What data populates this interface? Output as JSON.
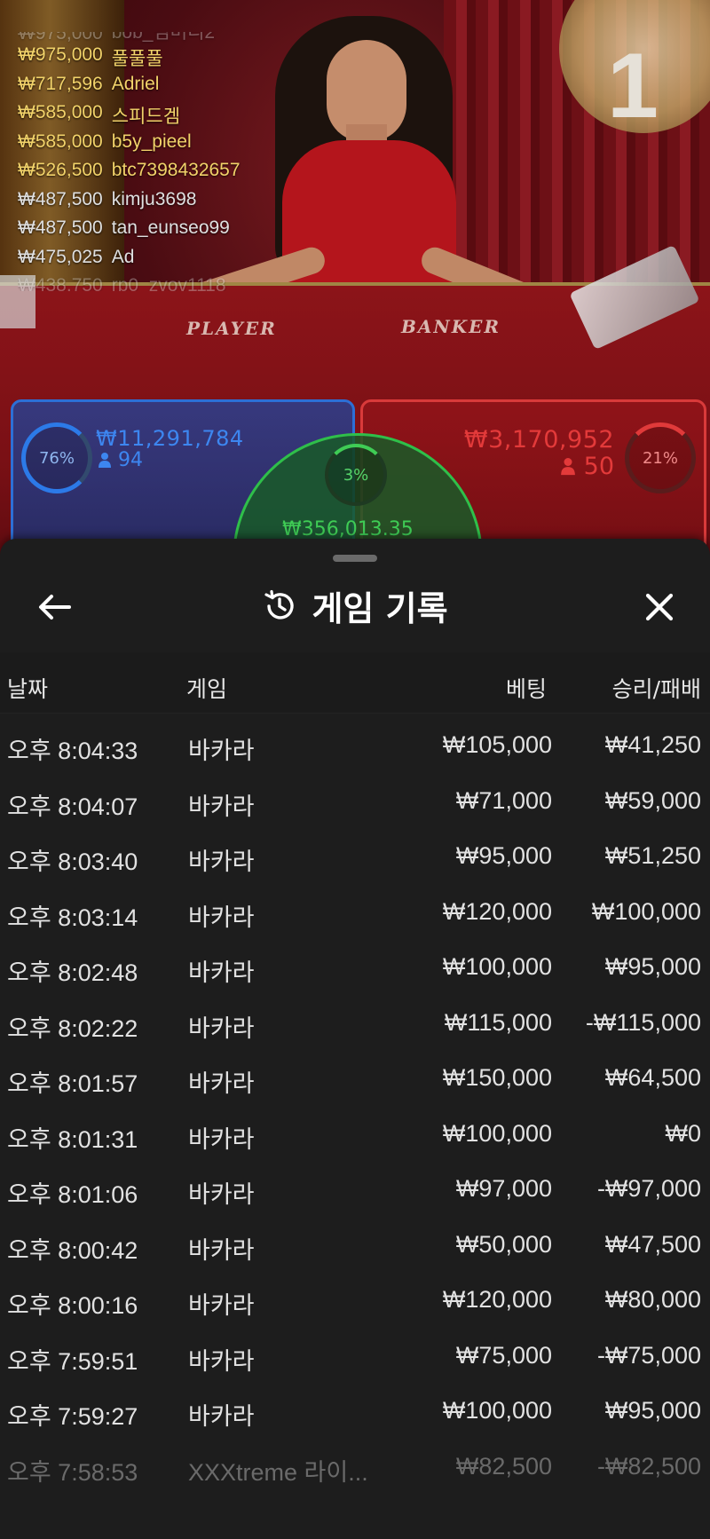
{
  "video": {
    "round_number": "1",
    "table_labels": {
      "player": "PLAYER",
      "banker": "BANKER"
    }
  },
  "leaderboard": [
    {
      "amount": "₩975,000",
      "name": "bob_님버리2",
      "tone": "cut"
    },
    {
      "amount": "₩975,000",
      "name": "풀풀풀",
      "tone": "gold"
    },
    {
      "amount": "₩717,596",
      "name": "Adriel",
      "tone": "gold"
    },
    {
      "amount": "₩585,000",
      "name": "스피드겜",
      "tone": "gold"
    },
    {
      "amount": "₩585,000",
      "name": "b5y_pieel",
      "tone": "gold"
    },
    {
      "amount": "₩526,500",
      "name": "btc7398432657",
      "tone": "gold"
    },
    {
      "amount": "₩487,500",
      "name": "kimju3698",
      "tone": "white"
    },
    {
      "amount": "₩487,500",
      "name": "tan_eunseo99",
      "tone": "white"
    },
    {
      "amount": "₩475,025",
      "name": "Ad",
      "tone": "white"
    },
    {
      "amount": "₩438,750",
      "name": "rp0_zvov1118",
      "tone": "cutb"
    }
  ],
  "bet_stats": {
    "player": {
      "percent": "76%",
      "amount": "₩11,291,784",
      "count": "94",
      "color": "#2c7ae8"
    },
    "banker": {
      "percent": "21%",
      "amount": "₩3,170,952",
      "count": "50",
      "color": "#e03a3a"
    },
    "tie": {
      "percent": "3%",
      "amount": "₩356,013.35",
      "color": "#3fcc55"
    }
  },
  "sheet": {
    "title": "게임 기록",
    "icons": {
      "back": "arrow-left-icon",
      "history": "history-icon",
      "close": "close-icon",
      "user": "user-icon"
    },
    "columns": {
      "date": "날짜",
      "game": "게임",
      "bet": "베팅",
      "result": "승리/패배"
    },
    "rows": [
      {
        "date": "오후 8:04:33",
        "game": "바카라",
        "bet": "₩105,000",
        "result": "₩41,250"
      },
      {
        "date": "오후 8:04:07",
        "game": "바카라",
        "bet": "₩71,000",
        "result": "₩59,000"
      },
      {
        "date": "오후 8:03:40",
        "game": "바카라",
        "bet": "₩95,000",
        "result": "₩51,250"
      },
      {
        "date": "오후 8:03:14",
        "game": "바카라",
        "bet": "₩120,000",
        "result": "₩100,000"
      },
      {
        "date": "오후 8:02:48",
        "game": "바카라",
        "bet": "₩100,000",
        "result": "₩95,000"
      },
      {
        "date": "오후 8:02:22",
        "game": "바카라",
        "bet": "₩115,000",
        "result": "-₩115,000"
      },
      {
        "date": "오후 8:01:57",
        "game": "바카라",
        "bet": "₩150,000",
        "result": "₩64,500"
      },
      {
        "date": "오후 8:01:31",
        "game": "바카라",
        "bet": "₩100,000",
        "result": "₩0"
      },
      {
        "date": "오후 8:01:06",
        "game": "바카라",
        "bet": "₩97,000",
        "result": "-₩97,000"
      },
      {
        "date": "오후 8:00:42",
        "game": "바카라",
        "bet": "₩50,000",
        "result": "₩47,500"
      },
      {
        "date": "오후 8:00:16",
        "game": "바카라",
        "bet": "₩120,000",
        "result": "₩80,000"
      },
      {
        "date": "오후 7:59:51",
        "game": "바카라",
        "bet": "₩75,000",
        "result": "-₩75,000"
      },
      {
        "date": "오후 7:59:27",
        "game": "바카라",
        "bet": "₩100,000",
        "result": "₩95,000"
      },
      {
        "date": "오후 7:58:53",
        "game": "XXXtreme 라이...",
        "bet": "₩82,500",
        "result": "-₩82,500"
      }
    ]
  }
}
